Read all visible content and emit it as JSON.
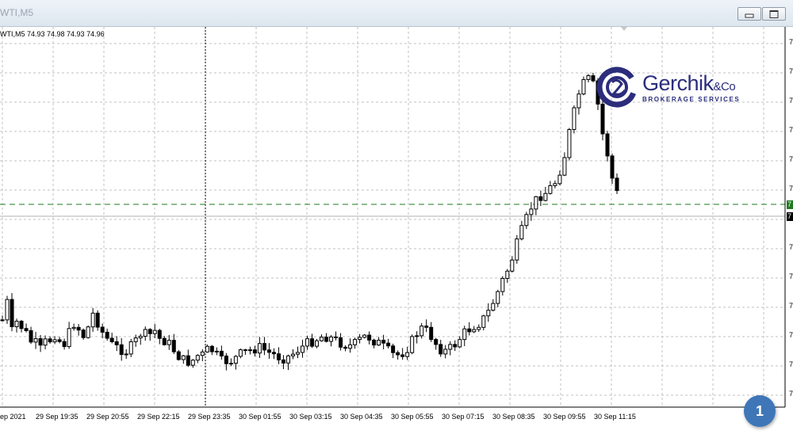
{
  "window": {
    "title": "WTI,M5",
    "buttons": {
      "minimize": "minimize-icon",
      "restore": "restore-icon"
    }
  },
  "chart": {
    "symbol_info": "WTI,M5  74.93 74.98 74.93 74.96",
    "logo_name": "Gerchik",
    "logo_amp": "&Co",
    "logo_sub": "BROKERAGE SERVICES",
    "badge": "1",
    "price_ticks": [
      "7",
      "7",
      "7",
      "7",
      "7",
      "7",
      "7",
      "7",
      "7",
      "7",
      "7",
      "7",
      "7"
    ],
    "price_label_green": "7",
    "price_label_black": "7",
    "time_labels": [
      "ep 2021",
      "29 Sep 19:35",
      "29 Sep 20:55",
      "29 Sep 22:15",
      "29 Sep 23:35",
      "30 Sep 01:55",
      "30 Sep 03:15",
      "30 Sep 04:35",
      "30 Sep 05:55",
      "30 Sep 07:15",
      "30 Sep 08:35",
      "30 Sep 09:55",
      "30 Sep 11:15"
    ],
    "colors": {
      "candle": "#000000",
      "grid": "#c0c0c0",
      "level_line": "#1f7a1f",
      "brand": "#2b2d7c",
      "badge": "#3e76b8"
    }
  },
  "chart_data": {
    "type": "candlestick",
    "title": "WTI,M5",
    "categories": [
      "ep 2021",
      "29 Sep 19:35",
      "29 Sep 20:55",
      "29 Sep 22:15",
      "29 Sep 23:35",
      "30 Sep 01:55",
      "30 Sep 03:15",
      "30 Sep 04:35",
      "30 Sep 05:55",
      "30 Sep 07:15",
      "30 Sep 08:35",
      "30 Sep 09:55",
      "30 Sep 11:15"
    ],
    "close_profile": [
      72,
      90,
      60,
      70,
      65,
      58,
      50,
      48,
      42,
      50,
      52,
      58,
      50,
      48,
      60,
      70,
      62,
      55,
      66,
      80,
      68,
      58,
      52,
      46,
      44,
      42,
      40,
      46,
      52,
      60,
      56,
      58,
      62,
      50,
      52,
      46,
      40,
      34,
      30,
      30,
      32,
      38,
      36,
      44,
      40,
      34,
      28,
      32,
      30,
      36,
      38,
      40,
      42,
      44,
      44,
      40,
      38,
      36,
      34,
      34,
      36,
      40,
      44,
      46,
      50,
      52,
      54,
      56,
      55,
      52,
      50,
      48,
      46,
      46,
      50,
      54,
      56,
      52,
      50,
      46,
      42,
      38,
      36,
      38,
      42,
      48,
      56,
      64,
      62,
      58,
      50,
      44,
      40,
      42,
      46,
      52,
      58,
      62,
      66,
      68,
      72,
      78,
      88,
      98,
      110,
      120,
      132,
      146,
      160,
      172,
      185,
      192,
      198,
      200,
      205,
      210,
      222,
      236,
      260,
      280,
      300,
      310,
      315,
      310,
      290,
      260,
      240,
      215,
      200
    ],
    "last_open": 74.93,
    "last_high": 74.98,
    "last_low": 74.93,
    "last_close": 74.96
  }
}
